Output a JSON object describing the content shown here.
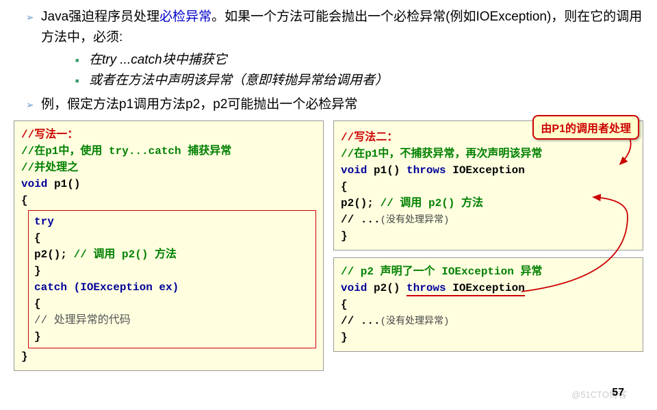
{
  "bullets": {
    "b1a": "Java强迫程序员处理",
    "b1_link": "必检异常",
    "b1b": "。如果一个方法可能会抛出一个必检异常(例如IOException)，则在它的调用方法中，必须:",
    "b1_sub1": "在try ...catch块中捕获它",
    "b1_sub2": "或者在方法中声明该异常（意即转抛异常给调用者）",
    "b2": "例，假定方法p1调用方法p2，p2可能抛出一个必检异常"
  },
  "left_code": {
    "l1": "//写法一：",
    "l2": "//在p1中，使用 try...catch 捕获异常",
    "l3": "//并处理之",
    "l4a": "void",
    "l4b": " p1()",
    "l5": "{",
    "inner": {
      "i1": "try",
      "i2": "{",
      "i3a": "    p2();  ",
      "i3b": "// 调用 p2() 方法",
      "i4": "}",
      "i5": "catch (IOException ex)",
      "i6": "{",
      "i7": "    // 处理异常的代码",
      "i8": "}"
    },
    "l6": "}"
  },
  "right_code1": {
    "r1": "//写法二：",
    "r2": "//在p1中，不捕获异常，再次声明该异常",
    "r3a": "void",
    "r3b": " p1() ",
    "r3c": "throws",
    "r3d": " IOException",
    "r4": "{",
    "r5a": "    p2(); ",
    "r5b": "// 调用 p2() 方法",
    "r6a": "    // ...",
    "r6b": "(没有处理异常)",
    "r7": "}"
  },
  "right_code2": {
    "s1": "// p2 声明了一个 IOException 异常",
    "s2a": "void",
    "s2b": " p2() ",
    "s2c": "throws",
    "s2d": " IOException",
    "s3": "{",
    "s4a": "    // ...",
    "s4b": "(没有处理异常)",
    "s5": "}"
  },
  "callout": "由P1的调用者处理",
  "page_num": "57",
  "watermark": "@51CTO博客"
}
